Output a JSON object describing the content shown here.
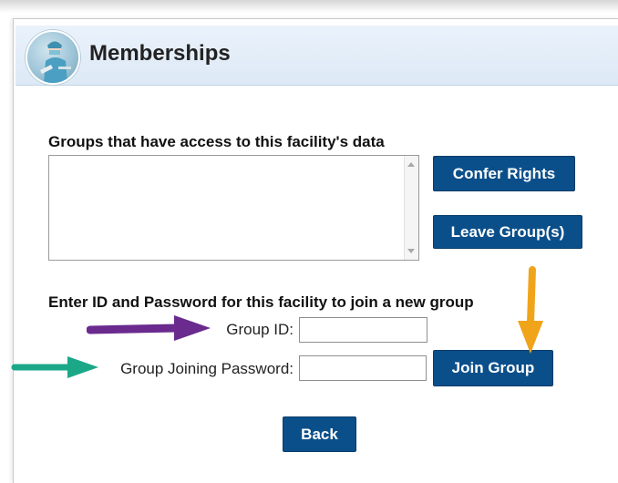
{
  "header": {
    "title": "Memberships",
    "avatar_icon": "nurse-avatar-icon"
  },
  "groups": {
    "list_label": "Groups that have access to this facility's data",
    "items": [],
    "confer_rights_label": "Confer Rights",
    "leave_groups_label": "Leave Group(s)"
  },
  "join": {
    "instruction": "Enter ID and Password for this facility to join a new group",
    "group_id_label": "Group ID:",
    "group_id_value": "",
    "password_label": "Group Joining Password:",
    "password_value": "",
    "join_button_label": "Join Group"
  },
  "back_label": "Back",
  "annotations": {
    "purple_arrow_color": "#6a2a8e",
    "teal_arrow_color": "#1aa889",
    "orange_arrow_color": "#f0a41a"
  },
  "colors": {
    "button_bg": "#0b4f8a",
    "header_bg": "#e4eef9"
  }
}
